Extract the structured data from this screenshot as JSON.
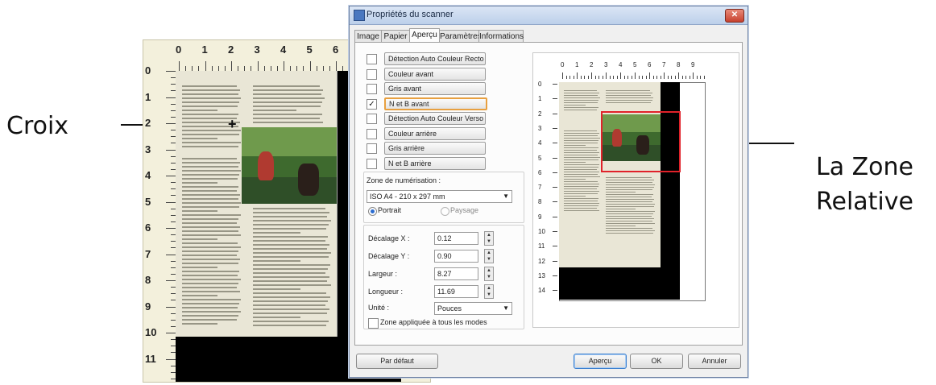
{
  "callouts": {
    "croix": "Croix",
    "zone_line1": "La Zone",
    "zone_line2": "Relative"
  },
  "left_preview": {
    "h_ruler": [
      "0",
      "1",
      "2",
      "3",
      "4",
      "5",
      "6"
    ],
    "v_ruler": [
      "0",
      "1",
      "2",
      "3",
      "4",
      "5",
      "6",
      "7",
      "8",
      "9",
      "10",
      "11"
    ],
    "crosshair_glyph": "+"
  },
  "dialog": {
    "title": "Propriétés du scanner",
    "close_glyph": "✕",
    "tabs": [
      "Image",
      "Papier",
      "Aperçu",
      "Paramètres",
      "Informations"
    ],
    "active_tab": "Aperçu",
    "image_options": [
      {
        "label": "Détection Auto Couleur Recto",
        "checked": false
      },
      {
        "label": "Couleur avant",
        "checked": false
      },
      {
        "label": "Gris avant",
        "checked": false
      },
      {
        "label": "N et B avant",
        "checked": true
      },
      {
        "label": "Détection Auto Couleur Verso",
        "checked": false
      },
      {
        "label": "Couleur arrière",
        "checked": false
      },
      {
        "label": "Gris arrière",
        "checked": false
      },
      {
        "label": "N et B arrière",
        "checked": false
      }
    ],
    "scan_zone": {
      "label": "Zone de numérisation :",
      "value": "ISO A4 - 210 x 297 mm",
      "portrait": "Portrait",
      "landscape": "Paysage",
      "orientation": "Portrait"
    },
    "fields": {
      "offset_x_label": "Décalage X :",
      "offset_x": "0.12",
      "offset_y_label": "Décalage Y :",
      "offset_y": "0.90",
      "width_label": "Largeur :",
      "width": "8.27",
      "length_label": "Longueur :",
      "length": "11.69",
      "unit_label": "Unité :",
      "unit": "Pouces",
      "apply_all": "Zone appliquée à tous les modes"
    },
    "preview_ruler_h": [
      "0",
      "1",
      "2",
      "3",
      "4",
      "5",
      "6",
      "7",
      "8",
      "9"
    ],
    "preview_ruler_v": [
      "0",
      "1",
      "2",
      "3",
      "4",
      "5",
      "6",
      "7",
      "8",
      "9",
      "10",
      "11",
      "12",
      "13",
      "14"
    ],
    "buttons": {
      "default": "Par défaut",
      "preview": "Aperçu",
      "ok": "OK",
      "cancel": "Annuler"
    }
  }
}
